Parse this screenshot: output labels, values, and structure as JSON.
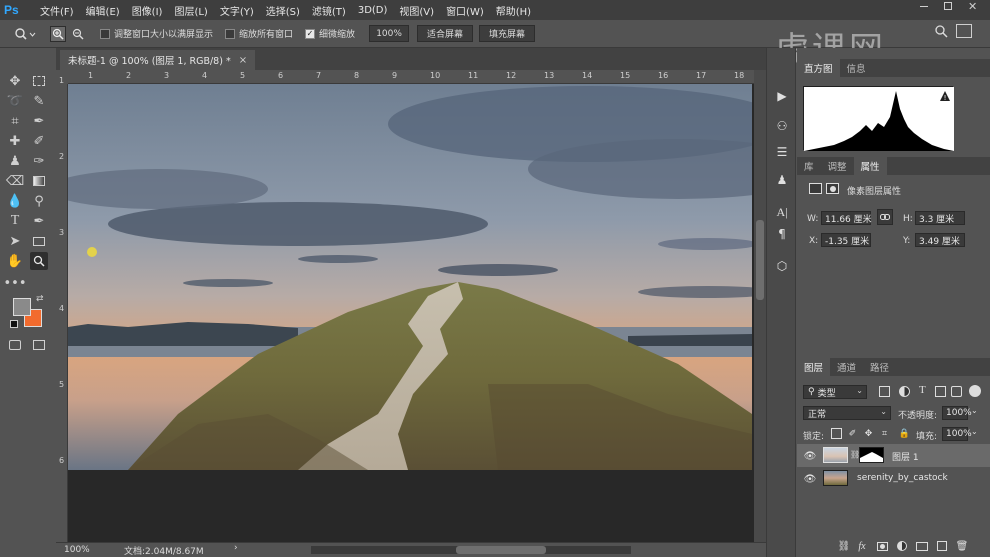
{
  "app": {
    "logo": "Ps",
    "menu": [
      "文件(F)",
      "编辑(E)",
      "图像(I)",
      "图层(L)",
      "文字(Y)",
      "选择(S)",
      "滤镜(T)",
      "3D(D)",
      "视图(V)",
      "窗口(W)",
      "帮助(H)"
    ]
  },
  "options": {
    "resize_windows_label": "调整窗口大小以满屏显示",
    "zoom_all_label": "缩放所有窗口",
    "scrubby_zoom_label": "细微缩放",
    "zoom_value": "100%",
    "fit_screen_label": "适合屏幕",
    "fill_screen_label": "填充屏幕"
  },
  "watermark": "虎课网",
  "document": {
    "tab_title": "未标题-1 @ 100% (图层 1, RGB/8) *",
    "close_glyph": "×"
  },
  "rulers": {
    "h_ticks": [
      "1",
      "2",
      "3",
      "4",
      "5",
      "6",
      "7",
      "8",
      "9",
      "10",
      "11",
      "12",
      "13",
      "14",
      "15",
      "16",
      "17",
      "18"
    ],
    "v_ticks": [
      "1",
      "2",
      "3",
      "4",
      "5",
      "6"
    ]
  },
  "status": {
    "zoom": "100%",
    "doc_size": "文档:2.04M/8.67M",
    "arrow": "›"
  },
  "panels": {
    "histogram_tabs": [
      "直方图",
      "信息"
    ],
    "warning_icon": "!",
    "props_tabs": [
      "库",
      "调整",
      "属性"
    ],
    "props_title": "像素图层属性",
    "w_label": "W:",
    "w_value": "11.66 厘米",
    "h_label": "H:",
    "h_value": "3.3 厘米",
    "x_label": "X:",
    "x_value": "-1.35 厘米",
    "y_label": "Y:",
    "y_value": "3.49 厘米",
    "layers_tabs": [
      "图层",
      "通道",
      "路径"
    ],
    "filter_kind": "类型",
    "blend_mode": "正常",
    "opacity_label": "不透明度:",
    "opacity_value": "100%",
    "lock_label": "锁定:",
    "fill_label": "填充:",
    "fill_value": "100%",
    "layers": [
      {
        "name": "图层 1",
        "selected": true
      },
      {
        "name": "serenity_by_castock",
        "selected": false
      }
    ],
    "fx_label": "fx"
  },
  "colors": {
    "foreground": "#8a8a8a",
    "background": "#f26b2e",
    "accent": "#31a8ff"
  }
}
